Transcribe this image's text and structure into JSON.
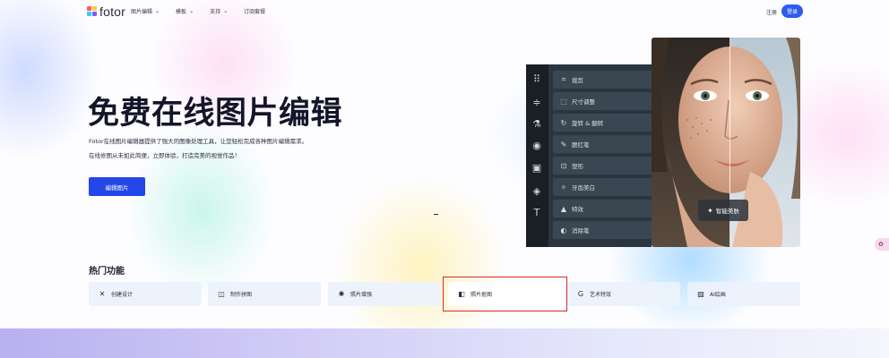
{
  "header": {
    "logo_text": "fotor",
    "nav": [
      {
        "label": "图片编辑",
        "has_dropdown": true
      },
      {
        "label": "模板",
        "has_dropdown": true
      },
      {
        "label": "支持",
        "has_dropdown": true
      },
      {
        "label": "订阅套餐",
        "has_dropdown": false
      }
    ],
    "register_label": "注册",
    "login_label": "登录"
  },
  "hero": {
    "title": "免费在线图片编辑",
    "desc_line1": "Fotor在线图片编辑器提供了强大的图像处理工具，让您轻松完成各种图片编辑需求。",
    "desc_line2": "在线修图从未如此简便，立即体验，打造完美的视觉作品！",
    "cta_label": "编辑图片"
  },
  "editor": {
    "rail_icons": [
      "grid-icon",
      "sliders-icon",
      "flask-icon",
      "eye-icon",
      "frame-icon",
      "shapes-icon",
      "text-icon"
    ],
    "tools": [
      {
        "label": "裁剪",
        "icon": "crop-icon"
      },
      {
        "label": "尺寸调整",
        "icon": "resize-icon"
      },
      {
        "label": "旋转 & 翻转",
        "icon": "rotate-icon"
      },
      {
        "label": "腮红笔",
        "icon": "blush-icon"
      },
      {
        "label": "塑形",
        "icon": "reshape-icon"
      },
      {
        "label": "牙齿美白",
        "icon": "tooth-icon"
      },
      {
        "label": "特效",
        "icon": "effects-icon"
      },
      {
        "label": "消除笔",
        "icon": "eraser-icon"
      }
    ],
    "badge_label": "智能美肤"
  },
  "hot": {
    "title": "热门功能",
    "cards": [
      {
        "label": "创建设计",
        "icon": "design-icon"
      },
      {
        "label": "制作拼图",
        "icon": "collage-icon"
      },
      {
        "label": "照片增强",
        "icon": "enhance-icon"
      },
      {
        "label": "照片抠图",
        "icon": "cutout-icon"
      },
      {
        "label": "艺术特效",
        "icon": "art-effect-icon"
      },
      {
        "label": "AI绘画",
        "icon": "ai-paint-icon"
      }
    ],
    "highlighted_index": 3
  },
  "colors": {
    "accent": "#2447e8",
    "highlight": "#d62828"
  }
}
